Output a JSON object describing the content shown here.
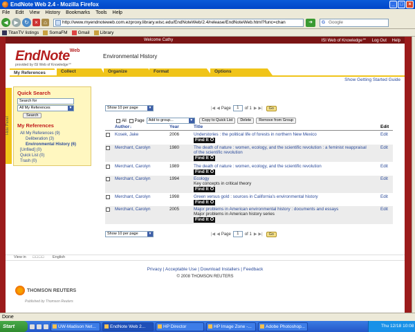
{
  "window": {
    "title": "EndNote Web 2.4 - Mozilla Firefox"
  },
  "menu": [
    "File",
    "Edit",
    "View",
    "History",
    "Bookmarks",
    "Tools",
    "Help"
  ],
  "nav": {
    "url": "http://www.myendnoteweb.com.ezproxy.library.wisc.edu/EndNoteWeb/2.4/release/EndNoteWeb.html?func=chan",
    "search_placeholder": "Google"
  },
  "bookmarks": [
    "TitanTV listings",
    "SomaFM",
    "Gmail",
    "Library"
  ],
  "header": {
    "welcome": "Welcome Cathy",
    "links": [
      "ISI Web of Knowledge℠",
      "Log Out",
      "Help"
    ],
    "logo_main": "EndNote",
    "logo_sup": "Web",
    "logo_tag": "provided by ISI Web of Knowledge℠"
  },
  "tabs": [
    "My References",
    "Collect",
    "Organize",
    "Format",
    "Options"
  ],
  "getting_started": "Show Getting Started Guide",
  "sidebar": {
    "hide_panel": "Hide Panel",
    "quick_search_title": "Quick Search",
    "search_for": "Search for",
    "search_scope": "All My References",
    "search_button": "Search",
    "my_refs_title": "My References",
    "items": [
      {
        "label": "All My References (9)",
        "sub": false,
        "bold": false
      },
      {
        "label": "Deliberation (3)",
        "sub": true,
        "bold": false
      },
      {
        "label": "Environmental History (6)",
        "sub": true,
        "bold": true
      },
      {
        "label": "[Unfiled] (0)",
        "sub": false,
        "bold": false
      },
      {
        "label": "Quick List (0)",
        "sub": false,
        "bold": false
      },
      {
        "label": "Trash (0)",
        "sub": false,
        "bold": false
      }
    ]
  },
  "main": {
    "title": "Environmental History",
    "per_page": "Show 10 per page",
    "page_label": "Page",
    "page_value": "1",
    "page_of": "of 1",
    "go": "Go",
    "all_label": "All",
    "page_cb_label": "Page",
    "add_group": "Add to group...",
    "copy_quick": "Copy to Quick List",
    "delete": "Delete",
    "remove_group": "Remove from Group",
    "columns": {
      "author": "Author",
      "year": "Year",
      "title": "Title",
      "edit": "Edit"
    },
    "find_it": "Find It",
    "edit_label": "Edit",
    "rows": [
      {
        "author": "Kosek, Jake",
        "year": "2006",
        "title": "Understories : the political life of forests in northern New Mexico",
        "series": ""
      },
      {
        "author": "Merchant, Carolyn",
        "year": "1980",
        "title": "The death of nature : women, ecology, and the scientific revolution : a feminist reappraisal of the scientific revolution",
        "series": ""
      },
      {
        "author": "Merchant, Carolyn",
        "year": "1989",
        "title": "The death of nature : women, ecology, and the scientific revolution",
        "series": ""
      },
      {
        "author": "Merchant, Carolyn",
        "year": "1994",
        "title": "Ecology",
        "series": "Key concepts in critical theory"
      },
      {
        "author": "Merchant, Carolyn",
        "year": "1998",
        "title": "Green versus gold : sources in California's environmental history",
        "series": ""
      },
      {
        "author": "Merchant, Carolyn",
        "year": "2005",
        "title": "Major problems in American environmental history : documents and essays",
        "series": "Major problems in American history series"
      }
    ]
  },
  "footer": {
    "view_in": "View in",
    "lang": "English",
    "links": "Privacy | Acceptable Use | Download Installers | Feedback",
    "copyright": "© 2008 THOMSON REUTERS",
    "brand": "THOMSON REUTERS",
    "published": "Published by Thomson Reuters"
  },
  "status": "Done",
  "taskbar": {
    "start": "Start",
    "tasks": [
      "UW-Madison Net...",
      "EndNote Web 2...",
      "HP Director",
      "HP Image Zone -...",
      "Adobe Photoshop..."
    ],
    "clock": "Thu 12/18 10:08"
  }
}
